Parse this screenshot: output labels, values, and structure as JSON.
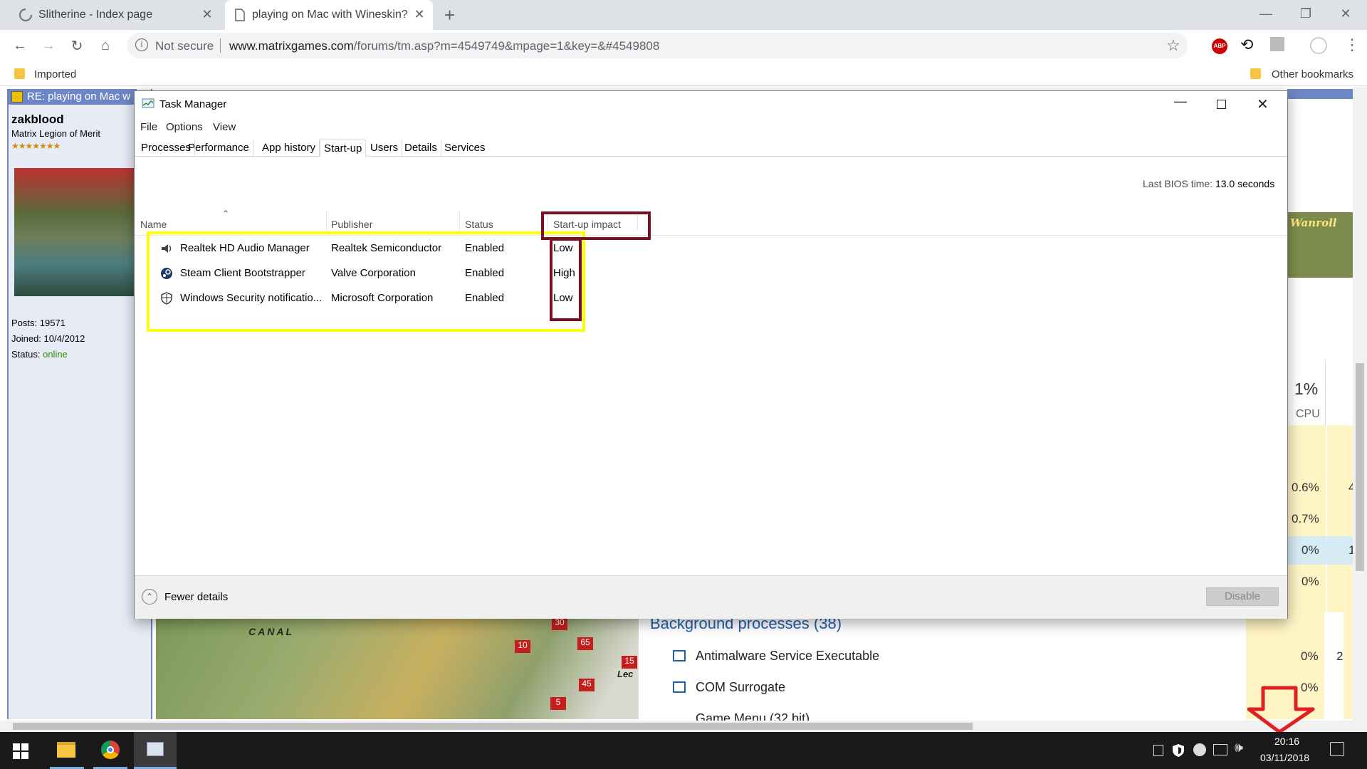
{
  "browser": {
    "tabs": [
      {
        "title": "Slitherine - Index page"
      },
      {
        "title": "playing on Mac with Wineskin?"
      }
    ],
    "security_label": "Not secure",
    "url_domain": "www.matrixgames.com",
    "url_path": "/forums/tm.asp?m=4549749&mpage=1&key=&#4549808",
    "bookmarks": {
      "left": "Imported",
      "right": "Other bookmarks"
    }
  },
  "forum": {
    "topic_title": "RE: playing on Mac w",
    "username": "zakblood",
    "rank": "Matrix Legion of Merit",
    "posts_label": "Posts:",
    "posts": "19571",
    "joined_label": "Joined:",
    "joined": "10/4/2012",
    "status_label": "Status:",
    "status": "online",
    "map_label": "Wanroll",
    "canal_label": "CANAL",
    "unit_labels": [
      "10",
      "30",
      "65",
      "15",
      "45",
      "5"
    ],
    "unit_place": "Lec"
  },
  "behind_task_manager": {
    "cpu_percent": "1%",
    "cpu_label": "CPU",
    "cpu_values": [
      "0.6%",
      "0.7%",
      "0%",
      "0%",
      "0%",
      "0%"
    ],
    "right_cut_values": [
      "4",
      "1",
      "2"
    ],
    "section_title": "Background processes (38)",
    "processes": [
      "Antimalware Service Executable",
      "COM Surrogate",
      "Game Menu (32 bit)"
    ]
  },
  "task_manager": {
    "title": "Task Manager",
    "menu": [
      "File",
      "Options",
      "View"
    ],
    "tabs": [
      "Processes",
      "Performance",
      "App history",
      "Start-up",
      "Users",
      "Details",
      "Services"
    ],
    "active_tab": "Start-up",
    "bios_label": "Last BIOS time:",
    "bios_value": "13.0 seconds",
    "columns": {
      "name": "Name",
      "publisher": "Publisher",
      "status": "Status",
      "impact": "Start-up impact"
    },
    "rows": [
      {
        "name": "Realtek HD Audio Manager",
        "publisher": "Realtek Semiconductor",
        "status": "Enabled",
        "impact": "Low",
        "icon": "speaker-icon"
      },
      {
        "name": "Steam Client Bootstrapper",
        "publisher": "Valve Corporation",
        "status": "Enabled",
        "impact": "High",
        "icon": "steam-icon"
      },
      {
        "name": "Windows Security notificatio...",
        "publisher": "Microsoft Corporation",
        "status": "Enabled",
        "impact": "Low",
        "icon": "shield-icon"
      }
    ],
    "fewer_details": "Fewer details",
    "disable_button": "Disable"
  },
  "taskbar": {
    "time": "20:16",
    "date": "03/11/2018"
  },
  "colors": {
    "highlight_yellow": "#ffff00",
    "highlight_maroon": "#7b1024",
    "arrow_red": "#e02020",
    "forum_blue": "#6d86c5",
    "status_online": "#2e8b00"
  }
}
